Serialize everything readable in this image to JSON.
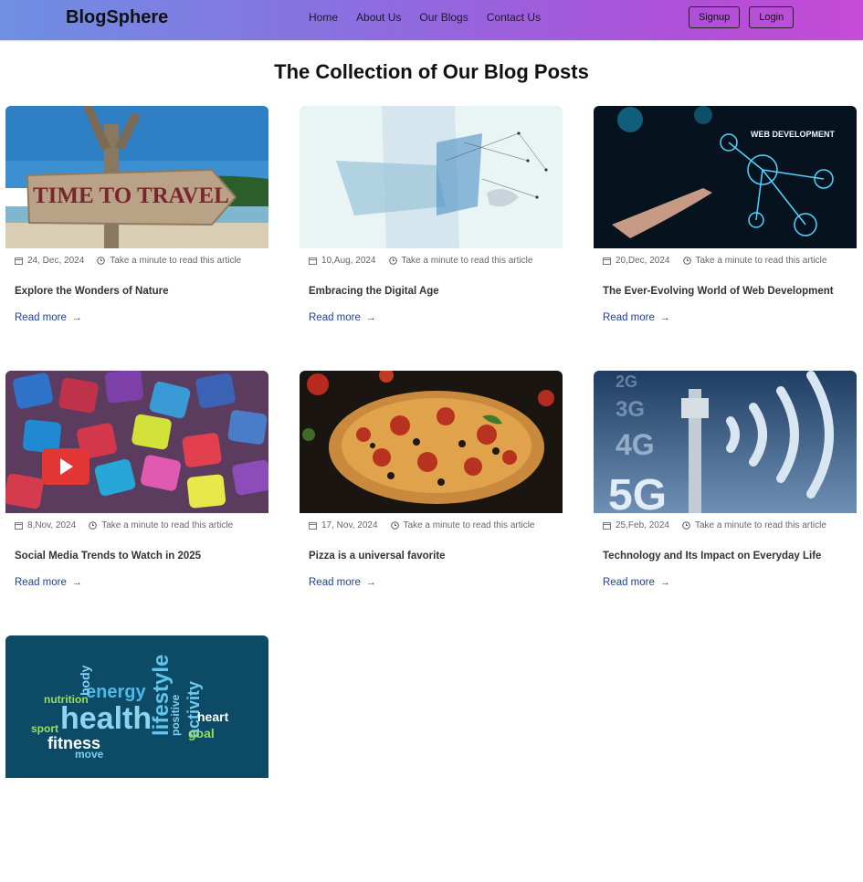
{
  "nav": {
    "brand": "BlogSphere",
    "links": [
      "Home",
      "About Us",
      "Our Blogs",
      "Contact Us"
    ],
    "signup": "Signup",
    "login": "Login"
  },
  "page": {
    "heading": "The Collection of Our Blog Posts"
  },
  "posts": [
    {
      "date": "24, Dec, 2024",
      "read": "Take a minute to read this article",
      "title": "Explore the Wonders of Nature",
      "more": "Read more",
      "image": "time-to-travel-sign",
      "image_text": "TIME TO TRAVEL"
    },
    {
      "date": "10,Aug, 2024",
      "read": "Take a minute to read this article",
      "title": "Embracing the Digital Age",
      "more": "Read more",
      "image": "digital-network-laptop"
    },
    {
      "date": "20,Dec, 2024",
      "read": "Take a minute to read this article",
      "title": "The Ever-Evolving World of Web Development",
      "more": "Read more",
      "image": "web-development-icons",
      "image_text": "WEB DEVELOPMENT"
    },
    {
      "date": "8,Nov, 2024",
      "read": "Take a minute to read this article",
      "title": "Social Media Trends to Watch in 2025",
      "more": "Read more",
      "image": "social-media-icons"
    },
    {
      "date": "17, Nov, 2024",
      "read": "Take a minute to read this article",
      "title": "Pizza is a universal favorite",
      "more": "Read more",
      "image": "pizza"
    },
    {
      "date": "25,Feb, 2024",
      "read": "Take a minute to read this article",
      "title": "Technology and Its Impact on Everyday Life",
      "more": "Read more",
      "image": "5g-tower",
      "image_text": [
        "2G",
        "3G",
        "4G",
        "5G"
      ]
    },
    {
      "date": "",
      "read": "",
      "title": "",
      "more": "",
      "image": "health-word-cloud",
      "image_text": [
        "health",
        "lifestyle",
        "energy",
        "fitness",
        "activity",
        "nutrition",
        "sport",
        "body",
        "positive",
        "heart",
        "goal",
        "move"
      ]
    }
  ]
}
